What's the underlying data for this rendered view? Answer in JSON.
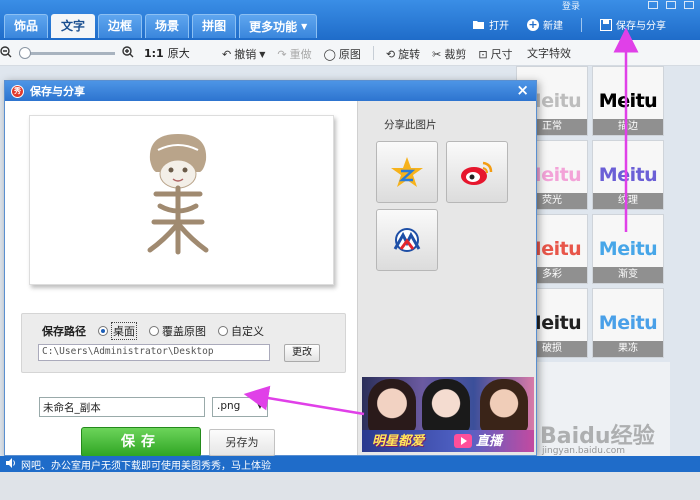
{
  "window": {
    "login_label": "登录"
  },
  "tabs": [
    {
      "label": "饰品"
    },
    {
      "label": "文字"
    },
    {
      "label": "边框"
    },
    {
      "label": "场景"
    },
    {
      "label": "拼图"
    },
    {
      "label": "更多功能"
    }
  ],
  "top_actions": {
    "open_label": "打开",
    "new_label": "新建",
    "save_share_label": "保存与分享"
  },
  "toolbar": {
    "zoom_ratio": "1:1",
    "original_size_label": "原大",
    "undo_label": "撤销",
    "redo_label": "重做",
    "original_label": "原图",
    "rotate_label": "旋转",
    "crop_label": "裁剪",
    "size_label": "尺寸"
  },
  "effects_panel": {
    "title": "文字特效",
    "items": [
      {
        "word": "Meitu",
        "caption": "正常",
        "color": "#bdbdbd"
      },
      {
        "word": "Meitu",
        "caption": "描边",
        "color": "#000000"
      },
      {
        "word": "Meitu",
        "caption": "荧光",
        "color": "#f3a3d8"
      },
      {
        "word": "Meitu",
        "caption": "纹理",
        "color": "#6b5fd6"
      },
      {
        "word": "Meitu",
        "caption": "多彩",
        "color": "#e8564a"
      },
      {
        "word": "Meitu",
        "caption": "渐变",
        "color": "#47a6e8"
      },
      {
        "word": "Meitu",
        "caption": "破损",
        "color": "#222222"
      },
      {
        "word": "Meitu",
        "caption": "果冻",
        "color": "#4aa0e8"
      }
    ]
  },
  "dialog": {
    "title": "保存与分享",
    "close_label": "×",
    "save_path_label": "保存路径",
    "path_options": [
      {
        "label": "桌面",
        "checked": true
      },
      {
        "label": "覆盖原图",
        "checked": false
      },
      {
        "label": "自定义",
        "checked": false
      }
    ],
    "path_value": "C:\\Users\\Administrator\\Desktop",
    "change_button_label": "更改",
    "filename_value": "未命名_副本",
    "extension_value": ".png",
    "save_button_label": "保存",
    "save_as_button_label": "另存为",
    "share_title": "分享此图片",
    "banner_text": "明星都爱",
    "banner_text2": "直播"
  },
  "status_bar": {
    "text": "网吧、办公室用户无须下载即可使用美图秀秀，马上体验"
  },
  "watermark": {
    "text": "Baidu经验",
    "url": "jingyan.baidu.com"
  }
}
